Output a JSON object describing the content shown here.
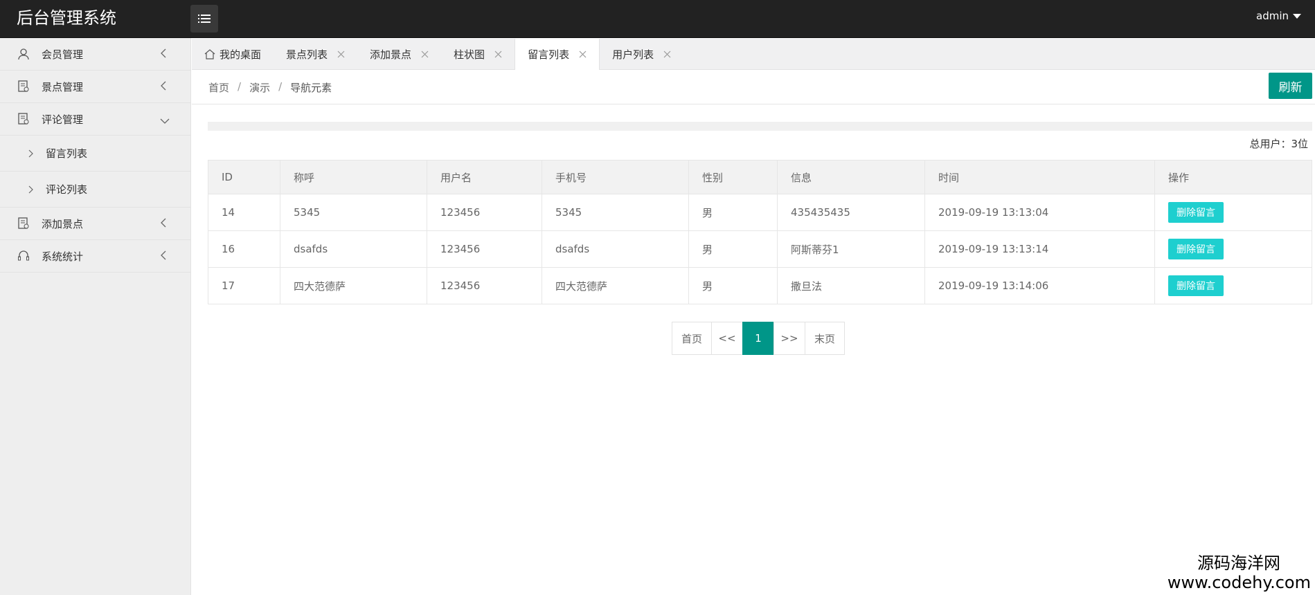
{
  "header": {
    "title": "后台管理系统",
    "user": "admin"
  },
  "sidebar": {
    "items": [
      {
        "label": "会员管理"
      },
      {
        "label": "景点管理"
      },
      {
        "label": "评论管理"
      },
      {
        "label": "添加景点"
      },
      {
        "label": "系统统计"
      }
    ],
    "sub_items": [
      {
        "label": "留言列表"
      },
      {
        "label": "评论列表"
      }
    ]
  },
  "tabs": [
    {
      "label": "我的桌面"
    },
    {
      "label": "景点列表"
    },
    {
      "label": "添加景点"
    },
    {
      "label": "柱状图"
    },
    {
      "label": "留言列表"
    },
    {
      "label": "用户列表"
    }
  ],
  "breadcrumb": {
    "items": [
      "首页",
      "演示",
      "导航元素"
    ],
    "separator": "/"
  },
  "refresh_label": "刷新",
  "total_label": "总用户：3位",
  "table": {
    "headers": [
      "ID",
      "称呼",
      "用户名",
      "手机号",
      "性别",
      "信息",
      "时间",
      "操作"
    ],
    "rows": [
      [
        "14",
        "5345",
        "123456",
        "5345",
        "男",
        "435435435",
        "2019-09-19 13:13:04"
      ],
      [
        "16",
        "dsafds",
        "123456",
        "dsafds",
        "男",
        "阿斯蒂芬1",
        "2019-09-19 13:13:14"
      ],
      [
        "17",
        "四大范德萨",
        "123456",
        "四大范德萨",
        "男",
        "撒旦法",
        "2019-09-19 13:14:06"
      ]
    ],
    "action_label": "删除留言"
  },
  "pagination": {
    "first": "首页",
    "prev": "<<",
    "current": "1",
    "next": ">>",
    "last": "末页"
  },
  "watermark": {
    "line1": "源码海洋网",
    "line2": "www.codehy.com"
  },
  "colors": {
    "header_bg": "#222222",
    "accent": "#009688",
    "delete_button": "#1ecfcf"
  }
}
